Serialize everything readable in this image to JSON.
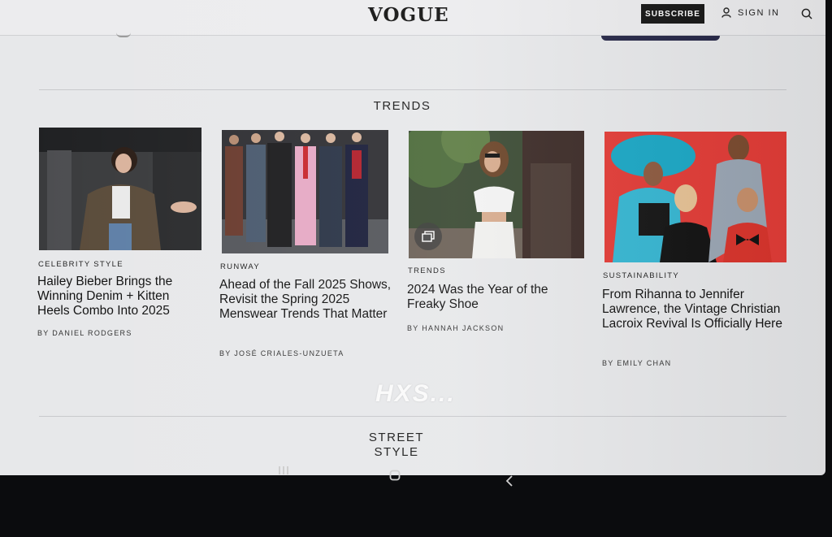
{
  "header": {
    "logo": "VOGUE",
    "subscribe_label": "SUBSCRIBE",
    "signin_label": "SIGN IN",
    "icons": [
      "user-icon",
      "search-icon"
    ]
  },
  "trends": {
    "title": "TRENDS",
    "cards": [
      {
        "kicker": "CELEBRITY STYLE",
        "headline": "Hailey Bieber Brings the Winning Denim + Kitten Heels Combo Into 2025",
        "byline": "BY DANIEL RODGERS"
      },
      {
        "kicker": "RUNWAY",
        "headline": "Ahead of the Fall 2025 Shows, Revisit the Spring 2025 Menswear Trends That Matter",
        "byline": "BY JOSÉ CRIALES-UNZUETA"
      },
      {
        "kicker": "TRENDS",
        "headline": "2024 Was the Year of the Freaky Shoe",
        "byline": "BY HANNAH JACKSON"
      },
      {
        "kicker": "SUSTAINABILITY",
        "headline": "From Rihanna to Jennifer Lawrence, the Vintage Christian Lacroix Revival Is Officially Here",
        "byline": "BY EMILY CHAN"
      }
    ]
  },
  "watermark": "HXS...",
  "street_style": {
    "line1": "STREET",
    "line2": "STYLE"
  },
  "colors": {
    "subscribe_bg": "#151515",
    "page_bg": "#e7e8ea",
    "photo4_bg": "#e23b36"
  }
}
